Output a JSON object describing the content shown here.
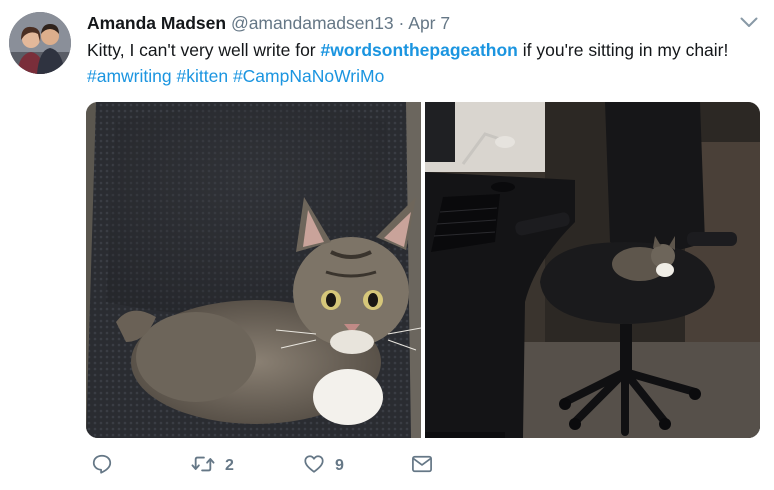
{
  "tweet": {
    "author_name": "Amanda Madsen",
    "handle": "@amandamadsen13",
    "separator": "·",
    "date": "Apr 7",
    "text_part1": "Kitty, I can't very well write for ",
    "hashtag_main": "#wordsonthepageathon",
    "text_part2": " if you're sitting in my chair! ",
    "hashtag_1": "#amwriting",
    "hashtag_2": "#kitten",
    "hashtag_3": "#CampNaNoWriMo"
  },
  "media": {
    "photos": [
      {
        "subject": "kitten-closeup-on-chair"
      },
      {
        "subject": "kitten-on-office-chair-at-desk"
      }
    ]
  },
  "actions": {
    "reply_icon": "reply-icon",
    "retweet_icon": "retweet-icon",
    "retweet_count": "2",
    "like_icon": "heart-icon",
    "like_count": "9",
    "dm_icon": "envelope-icon"
  },
  "colors": {
    "link": "#1b95e0",
    "secondary_text": "#657786",
    "primary_text": "#14171a"
  }
}
